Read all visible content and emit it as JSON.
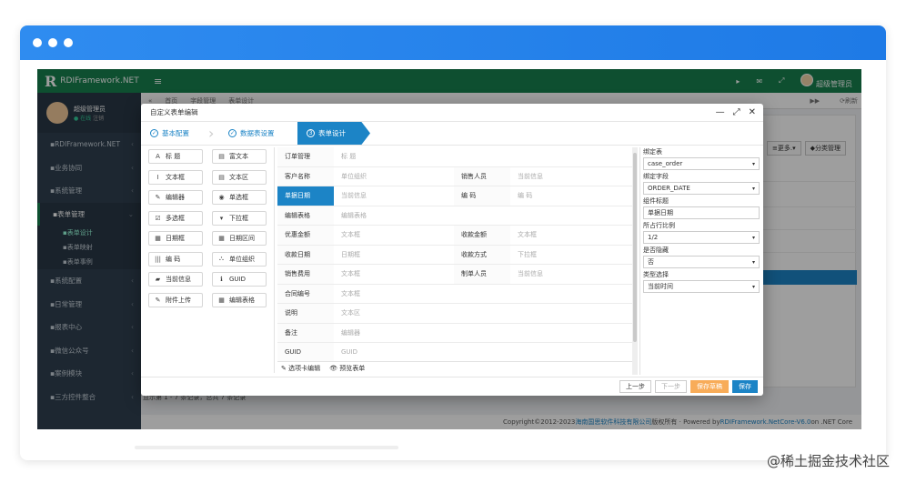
{
  "app": {
    "name": "RDIFramework.NET",
    "logo_letter": "R",
    "menu_glyph": "≡"
  },
  "topbar": {
    "icons": [
      "megaphone-icon",
      "mail-icon",
      "fullscreen-icon"
    ],
    "user": "超级管理员"
  },
  "sidebar": {
    "user_name": "超级管理员",
    "status": "● 在线",
    "logout": "注销",
    "items": [
      {
        "label": "RDIFramework.NET",
        "icon": "home-icon"
      },
      {
        "label": "业务协同",
        "icon": "share-icon"
      },
      {
        "label": "系统管理",
        "icon": "gears-icon"
      },
      {
        "label": "表单管理",
        "icon": "table-icon"
      },
      {
        "label": "表单设计",
        "icon": "table-icon",
        "sub": true
      },
      {
        "label": "表单映射",
        "icon": "link-icon",
        "sub": true
      },
      {
        "label": "表单事例",
        "icon": "refresh-icon",
        "sub": true
      },
      {
        "label": "系统配置",
        "icon": "cog-icon"
      },
      {
        "label": "日常管理",
        "icon": "calendar-icon"
      },
      {
        "label": "报表中心",
        "icon": "filter-icon"
      },
      {
        "label": "微信公众号",
        "icon": "wechat-icon"
      },
      {
        "label": "案例模块",
        "icon": "dashboard-icon"
      },
      {
        "label": "三方控件整合",
        "icon": "circle-icon"
      }
    ]
  },
  "tabs": {
    "items": [
      "首页",
      "字段管理",
      "表单设计"
    ],
    "refresh": "⟳刷新"
  },
  "grid": {
    "buttons": [
      "≡更多.▾",
      "◆分类管理"
    ],
    "pager": "显示第 1 - 7 条记录，总共 7 条记录"
  },
  "footer": {
    "copyright": "Copyright©2012-2023 ",
    "company": "海南国思软件科技有限公司",
    "rights": " 版权所有 · Powered by ",
    "product": "RDIFramework.NetCore-V6.0",
    "suffix": " on .NET Core"
  },
  "modal": {
    "title": "自定义表单编辑",
    "controls": {
      "minimize": "—",
      "maximize": "⤢",
      "close": "✕"
    },
    "steps": [
      {
        "label": "基本配置",
        "mark": "✓",
        "current": false
      },
      {
        "label": "数据表设置",
        "mark": "✓",
        "current": false
      },
      {
        "label": "表单设计",
        "mark": "3",
        "current": true
      }
    ],
    "palette": [
      {
        "label": "标 题",
        "icon": "A"
      },
      {
        "label": "富文本",
        "icon": "▤"
      },
      {
        "label": "文本框",
        "icon": "I"
      },
      {
        "label": "文本区",
        "icon": "▤"
      },
      {
        "label": "编辑器",
        "icon": "✎"
      },
      {
        "label": "单选框",
        "icon": "◉"
      },
      {
        "label": "多选框",
        "icon": "☑"
      },
      {
        "label": "下拉框",
        "icon": "▾"
      },
      {
        "label": "日期框",
        "icon": "▦"
      },
      {
        "label": "日期区间",
        "icon": "▦"
      },
      {
        "label": "编 码",
        "icon": "|||"
      },
      {
        "label": "单位组织",
        "icon": "⛬"
      },
      {
        "label": "当前信息",
        "icon": "▰"
      },
      {
        "label": "GUID",
        "icon": "ℹ"
      },
      {
        "label": "附件上传",
        "icon": "✎"
      },
      {
        "label": "编辑表格",
        "icon": "▦"
      }
    ],
    "rows": [
      {
        "label": "订单管理",
        "value": "标 题"
      },
      {
        "label": "客户名称",
        "value": "单位组织",
        "label2": "销售人员",
        "value2": "当前信息"
      },
      {
        "label": "单据日期",
        "value": "当前信息",
        "label2": "编 码",
        "value2": "编 码",
        "selected": true
      },
      {
        "label": "编辑表格",
        "value": "编辑表格"
      },
      {
        "label": "优惠金额",
        "value": "文本框",
        "label2": "收款金额",
        "value2": "文本框"
      },
      {
        "label": "收款日期",
        "value": "日期框",
        "label2": "收款方式",
        "value2": "下拉框"
      },
      {
        "label": "销售费用",
        "value": "文本框",
        "label2": "制单人员",
        "value2": "当前信息"
      },
      {
        "label": "合同编号",
        "value": "文本框"
      },
      {
        "label": "说明",
        "value": "文本区"
      },
      {
        "label": "备注",
        "value": "编辑器"
      },
      {
        "label": "GUID",
        "value": "GUID"
      }
    ],
    "bottom_tabs": [
      "选项卡编辑",
      "预览表单"
    ],
    "props": [
      {
        "title": "绑定表",
        "value": "case_order",
        "dropdown": true
      },
      {
        "title": "绑定字段",
        "value": "ORDER_DATE",
        "dropdown": true
      },
      {
        "title": "组件标题",
        "value": "单据日期",
        "dropdown": false
      },
      {
        "title": "所占行比例",
        "value": "1/2",
        "dropdown": true
      },
      {
        "title": "是否隐藏",
        "value": "否",
        "dropdown": true
      },
      {
        "title": "类型选择",
        "value": "当前时间",
        "dropdown": true
      }
    ],
    "footer_buttons": [
      "上一步",
      "下一步",
      "保存草稿",
      "保存"
    ]
  },
  "watermark": "@稀土掘金技术社区"
}
